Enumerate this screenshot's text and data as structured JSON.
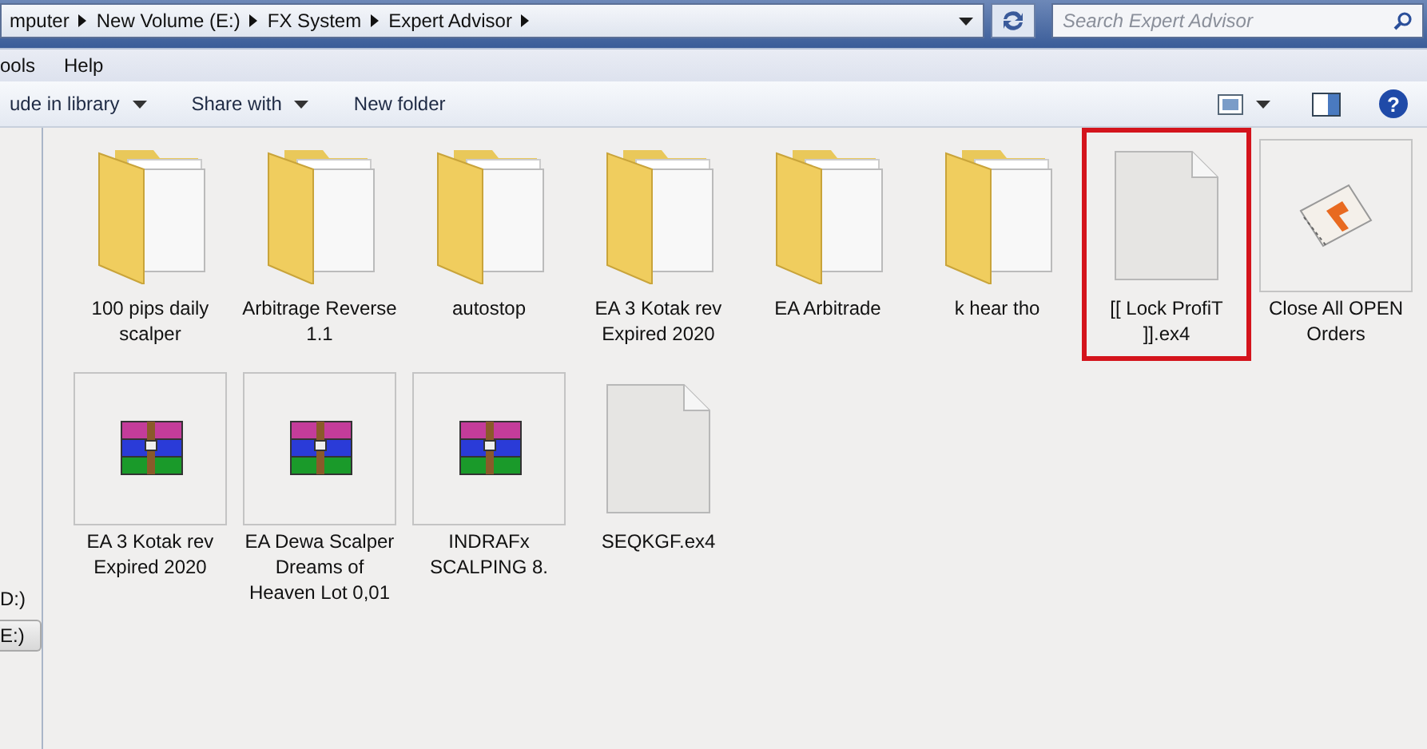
{
  "address_bar": {
    "breadcrumbs": [
      "mputer",
      "New Volume (E:)",
      "FX System",
      "Expert Advisor"
    ],
    "search": {
      "placeholder": "Search Expert Advisor"
    }
  },
  "menu_bar": [
    "ools",
    "Help"
  ],
  "toolbar": {
    "help": "?",
    "left": [
      {
        "label": "ude in library",
        "dropdown": true
      },
      {
        "label": "Share with",
        "dropdown": true
      },
      {
        "label": "New folder",
        "dropdown": false
      }
    ]
  },
  "sidebar": {
    "items": [
      {
        "label": "D:)",
        "selected": false
      },
      {
        "label": "E:)",
        "selected": true
      }
    ]
  },
  "files": [
    {
      "kind": "folder",
      "name": "100 pips daily scalper",
      "highlighted": false
    },
    {
      "kind": "folder",
      "name": "Arbitrage Reverse 1.1",
      "highlighted": false
    },
    {
      "kind": "folder",
      "name": "autostop",
      "highlighted": false
    },
    {
      "kind": "folder",
      "name": "EA 3 Kotak rev Expired 2020",
      "highlighted": false
    },
    {
      "kind": "folder",
      "name": "EA Arbitrade",
      "highlighted": false
    },
    {
      "kind": "folder",
      "name": "k hear tho",
      "highlighted": false
    },
    {
      "kind": "file",
      "name": "[[ Lock ProfiT ]].ex4",
      "highlighted": true
    },
    {
      "kind": "app",
      "name": "Close All OPEN Orders",
      "highlighted": false
    },
    {
      "kind": "archive",
      "name": "EA 3 Kotak rev Expired 2020",
      "highlighted": false
    },
    {
      "kind": "archive",
      "name": "EA Dewa Scalper Dreams of Heaven Lot 0,01",
      "highlighted": false
    },
    {
      "kind": "archive",
      "name": "INDRAFx SCALPING 8.",
      "highlighted": false
    },
    {
      "kind": "file",
      "name": "SEQKGF.ex4",
      "highlighted": false
    }
  ]
}
